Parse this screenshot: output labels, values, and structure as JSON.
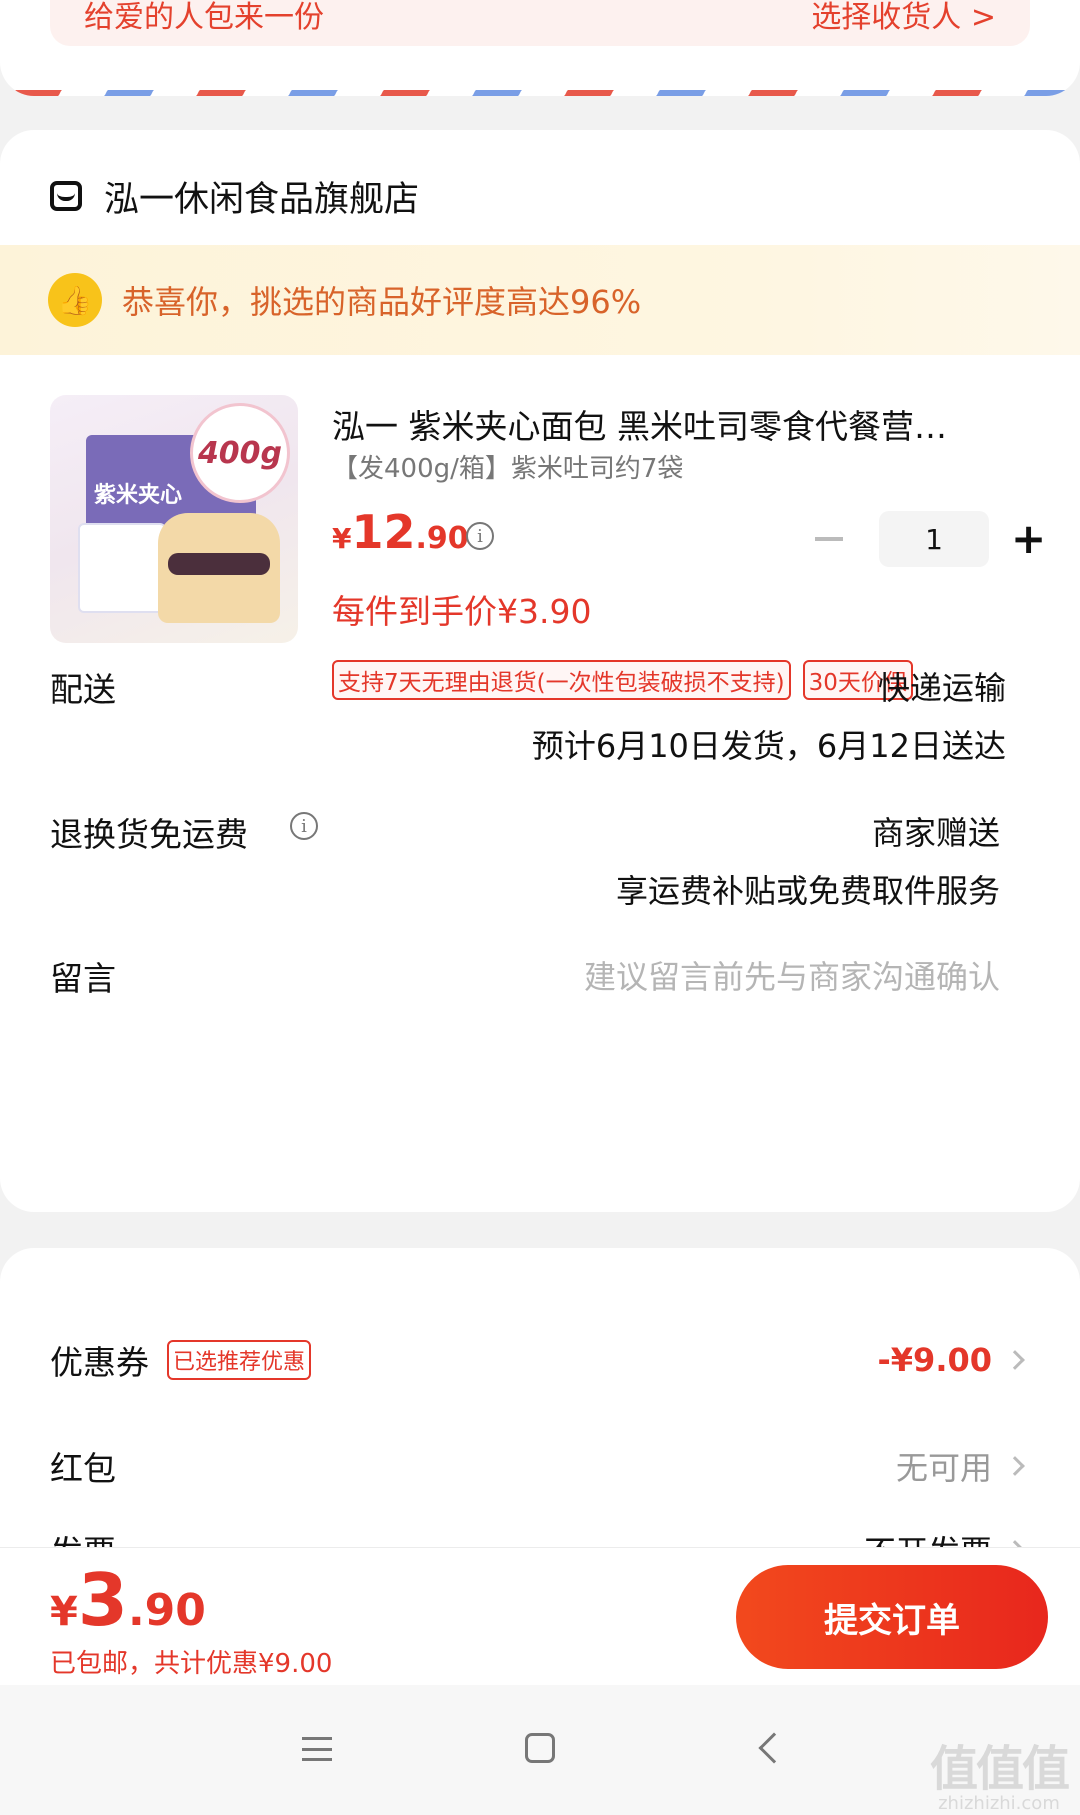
{
  "address": {
    "left_text": "给爱的人包来一份",
    "right_text": "选择收货人 >"
  },
  "store": {
    "name": "泓一休闲食品旗舰店",
    "praise": "恭喜你，挑选的商品好评度高达96%"
  },
  "product": {
    "image_text_box": "紫米夹心",
    "image_text_badge": "400g",
    "title": "泓一 紫米夹心面包 黑米吐司零食代餐营…",
    "spec": "【发400g/箱】紫米吐司约7袋",
    "price_currency": "¥",
    "price_int": "12",
    "price_dec": ".90",
    "quantity": "1",
    "final_price": "每件到手价¥3.90",
    "tags": [
      "支持7天无理由退货(一次性包装破损不支持)",
      "30天价保"
    ]
  },
  "delivery": {
    "label": "配送",
    "method": "快递运输",
    "estimate": "预计6月10日发货，6月12日送达"
  },
  "return_shipping": {
    "label": "退换货免运费",
    "value": "商家赠送",
    "detail": "享运费补贴或免费取件服务"
  },
  "message": {
    "label": "留言",
    "placeholder": "建议留言前先与商家沟通确认"
  },
  "discounts": {
    "coupon_label": "优惠券",
    "coupon_badge": "已选推荐优惠",
    "coupon_value": "-¥9.00",
    "redpacket_label": "红包",
    "redpacket_value": "无可用",
    "invoice_label": "发票",
    "invoice_value": "不开发票"
  },
  "footer": {
    "total_currency": "¥",
    "total_int": "3",
    "total_dec": ".90",
    "note": "已包邮，共计优惠¥9.00",
    "submit_label": "提交订单"
  },
  "watermark": {
    "big": "值值值",
    "small": "zhizhizhi.com"
  },
  "colors": {
    "accent_red": "#e4372a",
    "praise_orange": "#d8632a",
    "thumb_yellow": "#f8c31a"
  },
  "icons": [
    "store-icon",
    "thumbs-up-icon",
    "info-icon",
    "minus-icon",
    "plus-icon",
    "chevron-right-icon",
    "menu-icon",
    "home-icon",
    "back-icon"
  ]
}
